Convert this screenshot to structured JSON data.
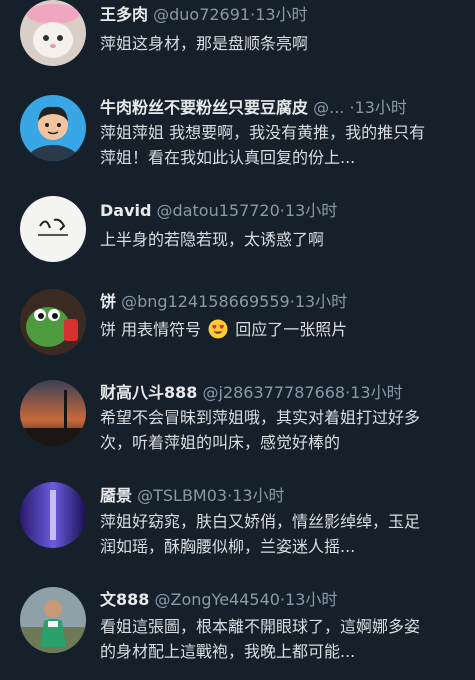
{
  "replies": [
    {
      "name": "王多肉",
      "handle": "@duo72691",
      "dot": "·",
      "time": "13小时",
      "text": "萍姐这身材，那是盘顺条亮啊",
      "avatar_icon": "cat-avatar"
    },
    {
      "name": "牛肉粉丝不要粉丝只要豆腐皮",
      "handle": "@...",
      "dot": "·",
      "time": "13小时",
      "text": "萍姐萍姐 我想要啊，我没有黄推，我的推只有萍姐！看在我如此认真回复的份上...",
      "avatar_icon": "cartoon-man-avatar"
    },
    {
      "name": "David",
      "handle": "@datou157720",
      "dot": "·",
      "time": "13小时",
      "text": "上半身的若隐若现，太诱惑了啊",
      "avatar_icon": "calligraphy-logo-avatar"
    },
    {
      "name": "饼",
      "handle": "@bng124158669559",
      "dot": "·",
      "time": "13小时",
      "text_before": "饼 用表情符号",
      "emoji": "heart-eyes-emoji",
      "text_after": "回应了一张照片",
      "avatar_icon": "frog-avatar"
    },
    {
      "name": "财高八斗888",
      "handle": "@j286377787668",
      "dot": "·",
      "time": "13小时",
      "text": "希望不会冒昧到萍姐哦，其实对着姐打过好多次，听着萍姐的叫床，感觉好棒的",
      "avatar_icon": "sunset-avatar"
    },
    {
      "name": "靥景",
      "handle": "@TSLBM03",
      "dot": "·",
      "time": "13小时",
      "text": "萍姐好窈窕，肤白又娇俏，情丝影绰绰，玉足润如瑶，酥胸腰似柳，兰姿迷人摇...",
      "avatar_icon": "purple-light-avatar"
    },
    {
      "name": "文888",
      "handle": "@ZongYe44540",
      "dot": "·",
      "time": "13小时",
      "text": "看姐這張圖，根本離不開眼球了，這婀娜多姿的身材配上這戰袍，我晚上都可能...",
      "avatar_icon": "man-outdoor-avatar"
    }
  ]
}
